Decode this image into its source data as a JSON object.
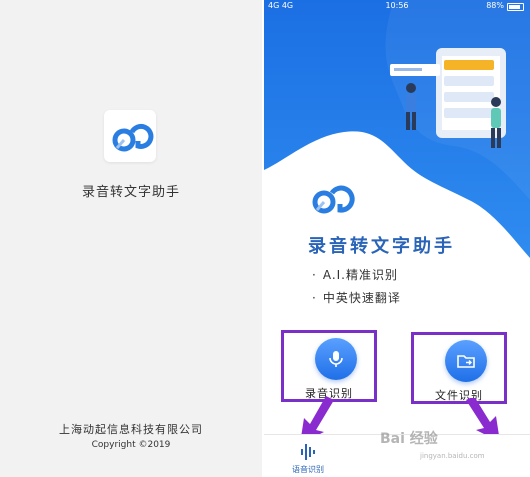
{
  "splash": {
    "app_name": "录音转文字助手",
    "company": "上海动起信息科技有限公司",
    "copyright": "Copyright ©2019",
    "logo_icon": "app-logo-icon"
  },
  "statusbar": {
    "signal": "4G 4G",
    "time": "10:56",
    "battery": "88%"
  },
  "home": {
    "app_title": "录音转文字助手",
    "features": [
      "A.I.精准识别",
      "中英快速翻译"
    ],
    "bullet": "·",
    "actions": {
      "voice": {
        "label": "录音识别",
        "icon": "microphone-icon"
      },
      "file": {
        "label": "文件识别",
        "icon": "folder-icon"
      }
    },
    "tabbar": {
      "voice_tab_label": "语音识别"
    }
  },
  "watermark": {
    "text": "Bai 经验",
    "sub": "jingyan.baidu.com"
  },
  "colors": {
    "brand_blue": "#1f6fe8",
    "highlight_purple": "#7b2fc9",
    "title_blue": "#2a64b8"
  }
}
